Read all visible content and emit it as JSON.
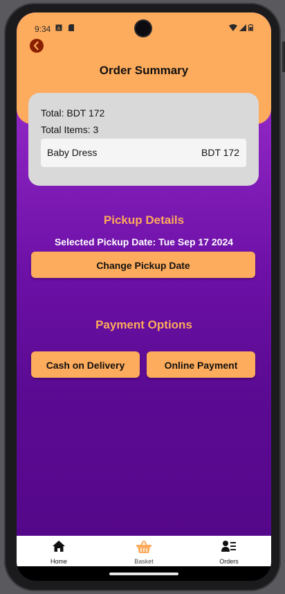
{
  "status_bar": {
    "time": "9:34"
  },
  "header": {
    "title": "Order Summary"
  },
  "summary": {
    "total": "Total: BDT 172",
    "total_items": "Total Items: 3",
    "items": [
      {
        "name": "Baby Dress",
        "price": "BDT 172"
      }
    ]
  },
  "pickup": {
    "section_title": "Pickup Details",
    "selected_date": "Selected Pickup Date: Tue Sep 17 2024",
    "change_button": "Change Pickup Date"
  },
  "payment": {
    "section_title": "Payment Options",
    "cash_button": "Cash on Delivery",
    "online_button": "Online Payment"
  },
  "bottom_nav": {
    "items": [
      {
        "label": "Home",
        "icon": "home-icon"
      },
      {
        "label": "Basket",
        "icon": "basket-icon",
        "active": true
      },
      {
        "label": "Orders",
        "icon": "orders-icon"
      }
    ]
  },
  "colors": {
    "accent": "#fdab5c",
    "purple": "#8a22bf",
    "card": "#d9d9d9",
    "back_button": "#8a1f00"
  }
}
